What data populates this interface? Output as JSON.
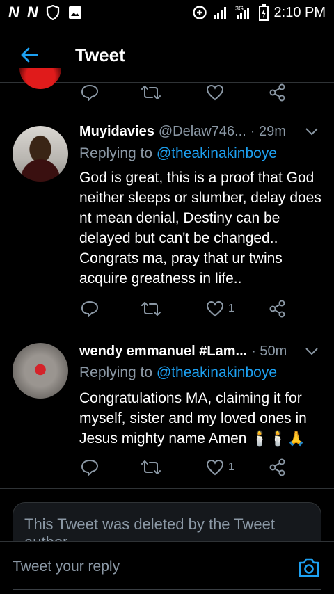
{
  "status_bar": {
    "left_icons": [
      "N",
      "N"
    ],
    "time": "2:10 PM",
    "network": "3G"
  },
  "header": {
    "title": "Tweet"
  },
  "tweets": [
    {
      "name": "Muyidavies",
      "handle": "@Delaw746...",
      "time": "· 29m",
      "replying_to_label": "Replying to",
      "replying_to_handle": "@theakinakinboye",
      "body": "God is great, this is a proof that God neither sleeps or slumber, delay does nt mean denial, Destiny can be delayed but can't be changed.. Congrats ma, pray that ur twins acquire greatness in life..",
      "like_count": "1"
    },
    {
      "name": "wendy emmanuel #Lam...",
      "handle": "",
      "time": "· 50m",
      "replying_to_label": "Replying to",
      "replying_to_handle": "@theakinakinboye",
      "body": "Congratulations MA, claiming it for myself, sister and my loved ones in Jesus mighty name Amen 🕯️🕯️🙏",
      "like_count": "1"
    }
  ],
  "deleted_notice": "This Tweet was deleted by the Tweet author",
  "reply_bar": {
    "placeholder": "Tweet your reply"
  },
  "colors": {
    "accent": "#1da1f2",
    "muted": "#8b98a5",
    "background": "#000000"
  }
}
